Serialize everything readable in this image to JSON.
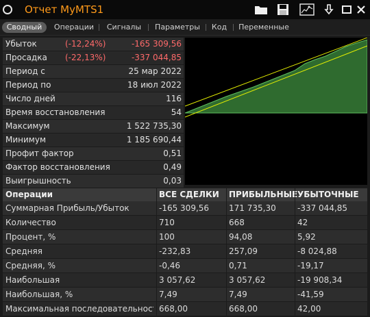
{
  "window": {
    "title": "Отчет MyMTS1"
  },
  "toolbar": {
    "icons": [
      "folder-icon",
      "save-icon",
      "chart-settings-icon",
      "download-arrow-icon",
      "minimize-icon",
      "close-icon"
    ]
  },
  "tabs": [
    {
      "label": "Сводный",
      "active": true
    },
    {
      "label": "Операции"
    },
    {
      "label": "Сигналы"
    },
    {
      "label": "Параметры"
    },
    {
      "label": "Код"
    },
    {
      "label": "Переменные"
    }
  ],
  "stats": [
    {
      "label": "Убыток",
      "pct": "(-12,24%)",
      "value": "-165 309,56"
    },
    {
      "label": "Просадка",
      "pct": "(-22,13%)",
      "value": "-337 044,85"
    },
    {
      "label": "Период с",
      "pct": "",
      "value": "25 мар 2022"
    },
    {
      "label": "Период по",
      "pct": "",
      "value": "18 июл 2022"
    },
    {
      "label": "Число дней",
      "pct": "",
      "value": "116"
    },
    {
      "label": "Время восстановления",
      "pct": "",
      "value": "54"
    },
    {
      "label": "Максимум",
      "pct": "",
      "value": "1 522 735,30"
    },
    {
      "label": "Минимум",
      "pct": "",
      "value": "1 185 690,44"
    },
    {
      "label": "Профит фактор",
      "pct": "",
      "value": "0,51"
    },
    {
      "label": "Фактор восстановления",
      "pct": "",
      "value": "0,49"
    },
    {
      "label": "Выигрышность",
      "pct": "",
      "value": "0,03"
    }
  ],
  "colors": {
    "accent": "#ff9a1a",
    "negative": "#ff6a6a",
    "equity_fill": "#2f6b2f",
    "channel_line": "#e6f000"
  },
  "ops": {
    "headers": [
      "Операции",
      "ВСЕ СДЕЛКИ",
      "ПРИБЫЛЬНЫЕ",
      "УБЫТОЧНЫЕ"
    ],
    "rows": [
      [
        "Суммарная Прибыль/Убыток",
        "-165 309,56",
        "171 735,30",
        "-337 044,85"
      ],
      [
        "Количество",
        "710",
        "668",
        "42"
      ],
      [
        "Процент, %",
        "100",
        "94,08",
        "5,92"
      ],
      [
        "Средняя",
        "-232,83",
        "257,09",
        "-8 024,88"
      ],
      [
        "Средняя, %",
        "-0,46",
        "0,71",
        "-19,17"
      ],
      [
        "Наибольшая",
        "3 057,62",
        "3 057,62",
        "-19 908,34"
      ],
      [
        "Наибольшая, %",
        "7,49",
        "7,49",
        "-41,59"
      ],
      [
        "Максимальная последовательность",
        "668,00",
        "668,00",
        "42,00"
      ]
    ]
  }
}
